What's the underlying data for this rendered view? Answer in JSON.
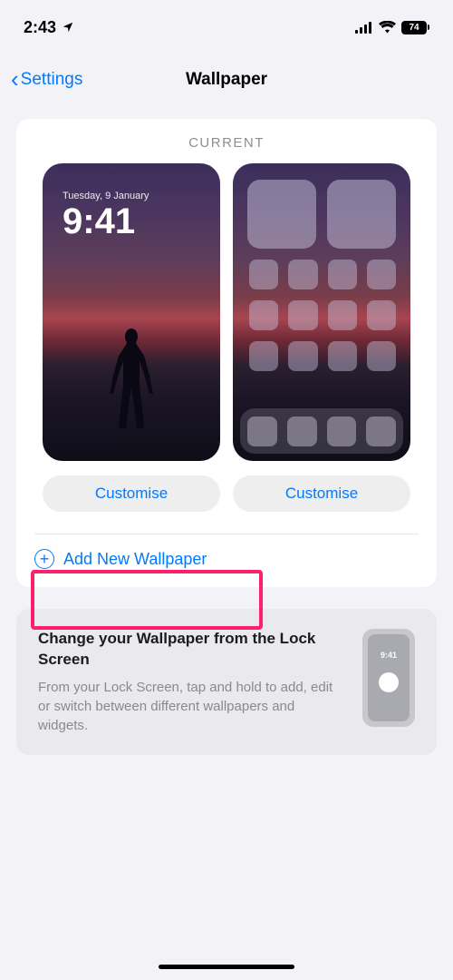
{
  "status": {
    "time": "2:43",
    "battery": "74"
  },
  "nav": {
    "back_label": "Settings",
    "title": "Wallpaper"
  },
  "current": {
    "header": "CURRENT",
    "lockscreen": {
      "date": "Tuesday, 9 January",
      "time": "9:41"
    },
    "customise_left": "Customise",
    "customise_right": "Customise",
    "add_label": "Add New Wallpaper"
  },
  "info": {
    "title": "Change your Wallpaper from the Lock Screen",
    "desc": "From your Lock Screen, tap and hold to add, edit or switch between different wallpapers and widgets.",
    "phone_time": "9:41"
  }
}
